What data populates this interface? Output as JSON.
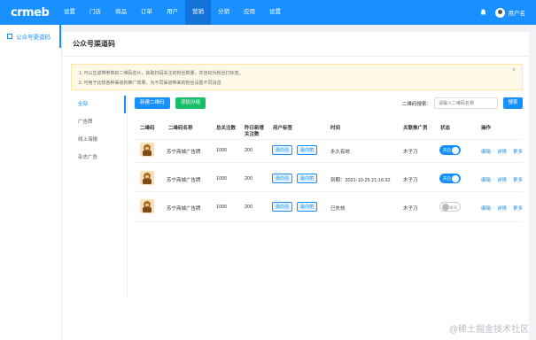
{
  "brand": {
    "logo_text": "crmeb"
  },
  "nav": {
    "items": [
      "设置",
      "门店",
      "商品",
      "订单",
      "用户",
      "营销",
      "分销",
      "应用",
      "设置"
    ],
    "active_index": 5
  },
  "user": {
    "name": "用户名"
  },
  "sidebar": {
    "items": [
      {
        "label": "公众号渠道码"
      }
    ]
  },
  "page": {
    "title": "公众号渠道码"
  },
  "notice": {
    "lines": [
      "1. 可以生成带参数的二维码名片，获取扫码关注的粉丝数量，并自动为粉丝打标签。",
      "2. 可用于比较各种渠道的推广效果，为不同渠道带来的粉丝设置不同消息"
    ],
    "close": "×"
  },
  "filter": {
    "items": [
      "全部",
      "广告牌",
      "线上海报",
      "杂志广告"
    ],
    "active_index": 0
  },
  "toolbar": {
    "new_button": "新建二维码",
    "group_button": "添加分组"
  },
  "search": {
    "label": "二维码搜索:",
    "placeholder": "请输入二维码名称",
    "button": "搜索"
  },
  "table": {
    "headers": {
      "qr": "二维码",
      "name": "二维码名称",
      "total": "总关注数",
      "yesterday_line1": "昨日新增",
      "yesterday_line2": "关注数",
      "tags": "用户标签",
      "time": "时间",
      "promoter": "关联推广员",
      "status": "状态",
      "actions": "操作"
    },
    "rows": [
      {
        "name": "苏宁商城广告牌",
        "total": "1000",
        "yesterday": "200",
        "tags": [
          "最向强",
          "最向丽"
        ],
        "time": "永久有效",
        "promoter": "木子刀",
        "status": "开启",
        "status_on": true
      },
      {
        "name": "苏宁商城广告牌",
        "total": "1000",
        "yesterday": "200",
        "tags": [
          "最向强",
          "最向丽"
        ],
        "time": "到期：2021-10-25 21:16:32",
        "promoter": "木子刀",
        "status": "开启",
        "status_on": true
      },
      {
        "name": "苏宁商城广告牌",
        "total": "1000",
        "yesterday": "200",
        "tags": [
          "最向强",
          "最向丽"
        ],
        "time": "已失效",
        "promoter": "木子刀",
        "status": "关闭",
        "status_on": false
      }
    ],
    "actions": {
      "edit": "编辑",
      "detail": "详情",
      "more": "更多",
      "separator": "|"
    }
  },
  "watermark": "@稀土掘金技术社区",
  "colors": {
    "primary": "#1890ff",
    "success": "#19be6b",
    "notice_bg": "#fff8e6"
  }
}
